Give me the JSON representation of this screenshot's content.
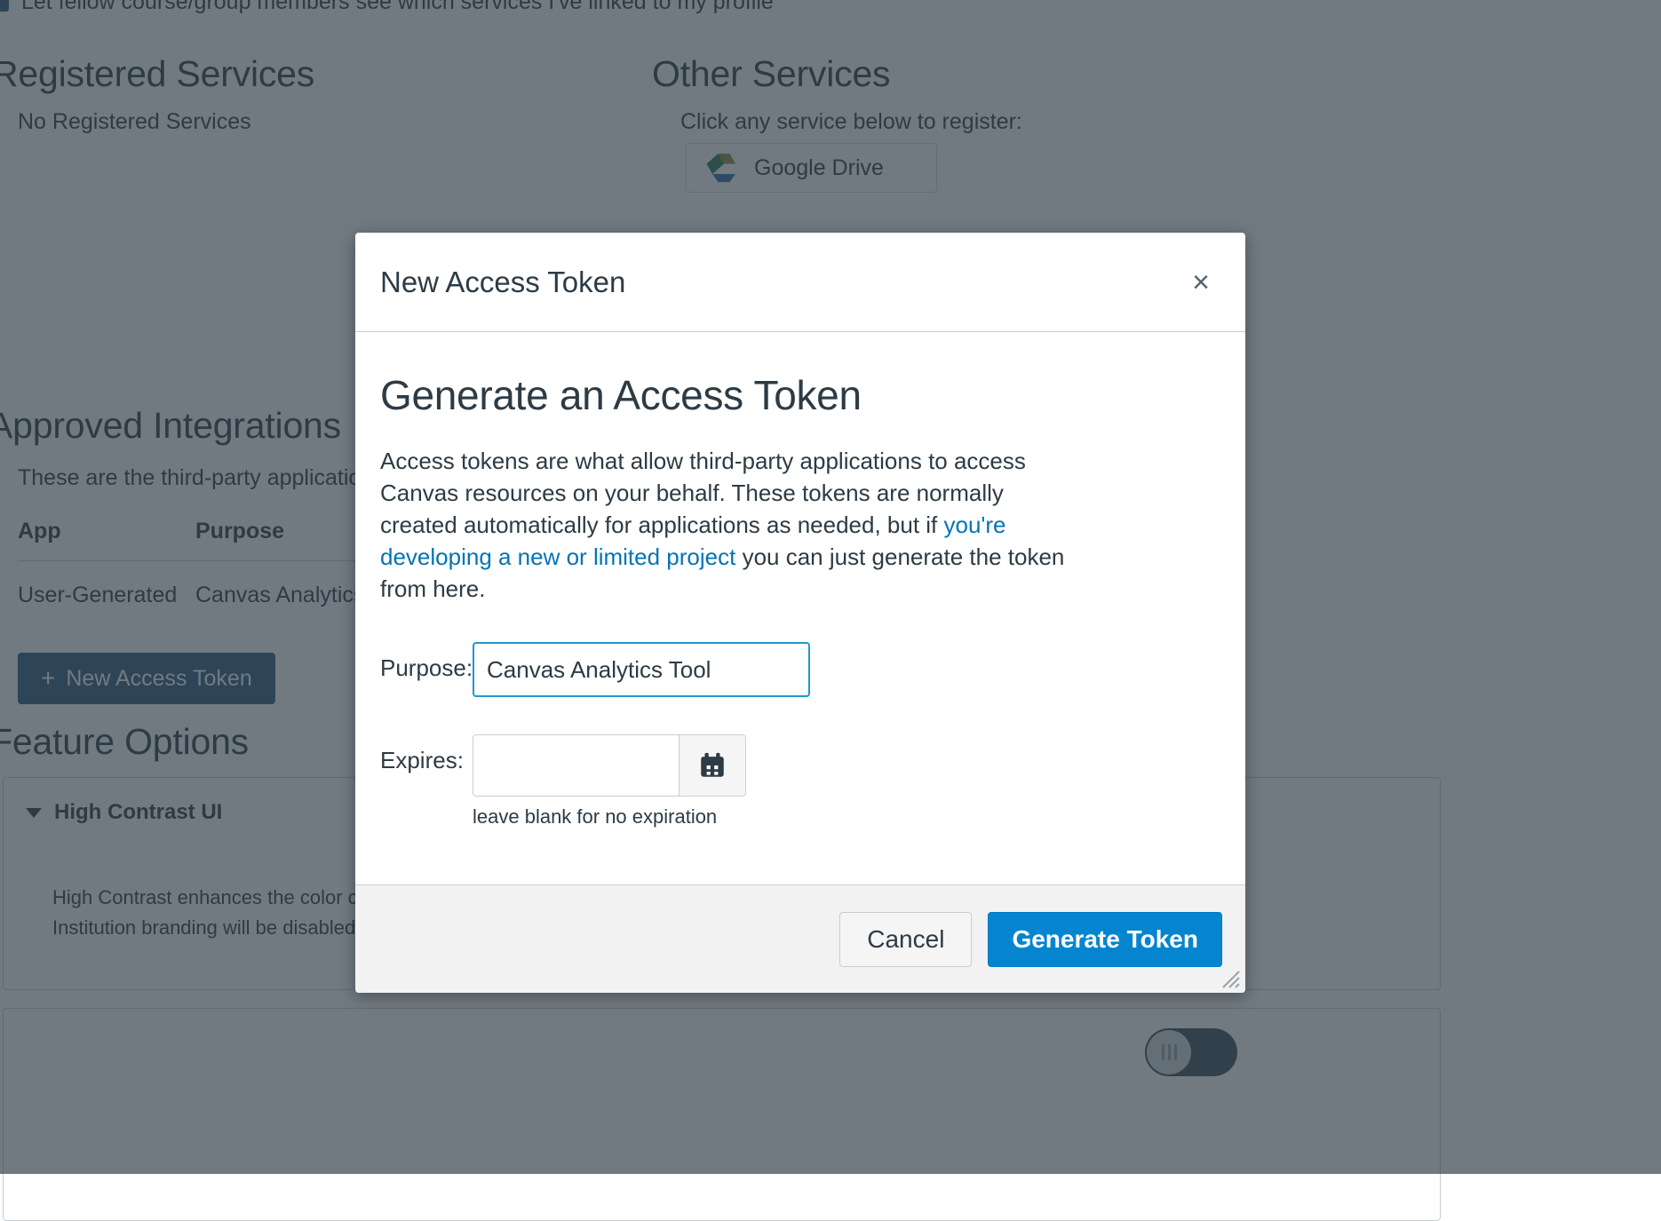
{
  "background": {
    "privacy_checkbox_label": "Let fellow course/group members see which services I've linked to my profile",
    "registered_services": {
      "heading": "Registered Services",
      "empty_text": "No Registered Services"
    },
    "other_services": {
      "heading": "Other Services",
      "hint": "Click any service below to register:",
      "tiles": [
        {
          "label": "Google Drive",
          "icon": "google-drive-icon"
        }
      ]
    },
    "approved_integrations": {
      "heading": "Approved Integrations",
      "description": "These are the third-party applications",
      "columns": [
        "App",
        "Purpose"
      ],
      "rows": [
        {
          "app": "User-Generated",
          "purpose": "Canvas Analytics Tool"
        }
      ],
      "new_token_button": "New Access Token",
      "new_token_plus": "+"
    },
    "feature_options": {
      "heading": "Feature Options",
      "features": [
        {
          "name": "High Contrast UI",
          "description": "High Contrast enhances the color contrast of the UI (text, buttons, etc.), making those items more distinct and easier to identify. Note: Institution branding will be disabled.",
          "toggle_state": "off",
          "toggle_glyph": "✖"
        }
      ]
    }
  },
  "modal": {
    "title": "New Access Token",
    "close_label": "×",
    "heading": "Generate an Access Token",
    "paragraph": {
      "part1": "Access tokens are what allow third-party applications to access Canvas resources on your behalf. These tokens are normally created automatically for applications as needed, but if ",
      "link": "you're developing a new or limited project",
      "part2": " you can just generate the token from here."
    },
    "form": {
      "purpose_label": "Purpose:",
      "purpose_value": "Canvas Analytics Tool",
      "purpose_placeholder": "",
      "expires_label": "Expires:",
      "expires_value": "",
      "expires_placeholder": "",
      "calendar_icon": "calendar-icon",
      "expires_hint": "leave blank for no expiration"
    },
    "footer": {
      "cancel_label": "Cancel",
      "generate_label": "Generate Token"
    }
  },
  "colors": {
    "brand_blue": "#0585CF",
    "link_blue": "#0374B5",
    "focus_blue": "#2098D1",
    "dark_slate": "#2D3B45",
    "dim_overlay": "rgba(45,59,69,0.68)",
    "button_navy": "#2D5B7D"
  }
}
